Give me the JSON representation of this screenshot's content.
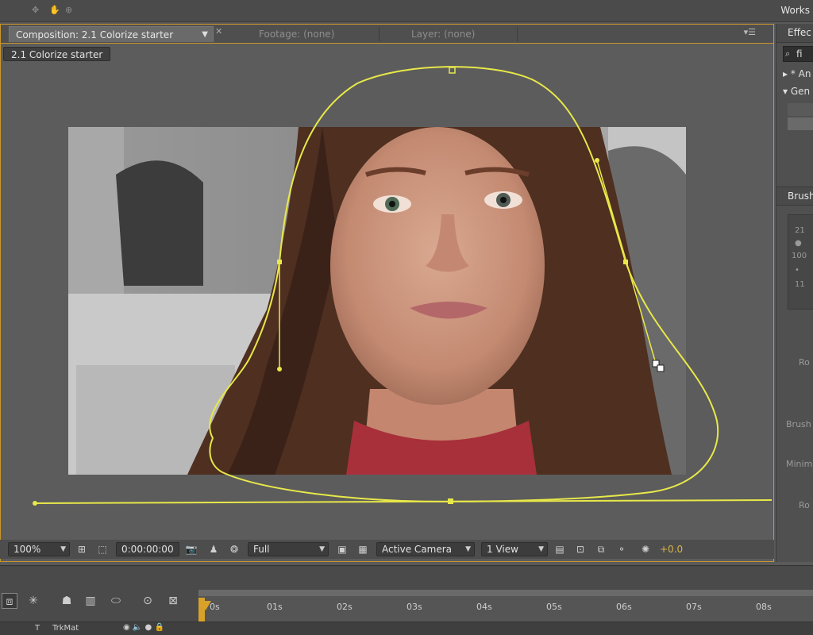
{
  "app": {
    "workspace_label": "Works"
  },
  "comp_panel": {
    "tabs": [
      {
        "label": "Composition: 2.1 Colorize starter"
      },
      {
        "label": "Footage: (none)"
      },
      {
        "label": "Layer: (none)"
      }
    ],
    "breadcrumb": "2.1 Colorize starter",
    "panel_menu_icon": "panel-menu-icon"
  },
  "comp_toolbar": {
    "zoom": "100%",
    "timecode": "0:00:00:00",
    "resolution": "Full",
    "camera": "Active Camera",
    "views": "1 View",
    "exposure": "+0.0"
  },
  "right_panel": {
    "effects_title": "Effec",
    "search_value": "fi",
    "tree": [
      {
        "label": "* An"
      },
      {
        "label": "Gen"
      }
    ],
    "brushes_title": "Brush",
    "brush_values": [
      "21",
      "100",
      "11"
    ],
    "labels": [
      "Ro",
      "Brush",
      "Minim",
      "Ro"
    ]
  },
  "timeline": {
    "ticks": [
      "0s",
      "01s",
      "02s",
      "03s",
      "04s",
      "05s",
      "06s",
      "07s",
      "08s"
    ],
    "trkmat_label": "TrkMat",
    "type_label": "T"
  },
  "colors": {
    "accent": "#c8962c",
    "mask_path": "#e8e84a",
    "cti": "#d8a22a"
  }
}
